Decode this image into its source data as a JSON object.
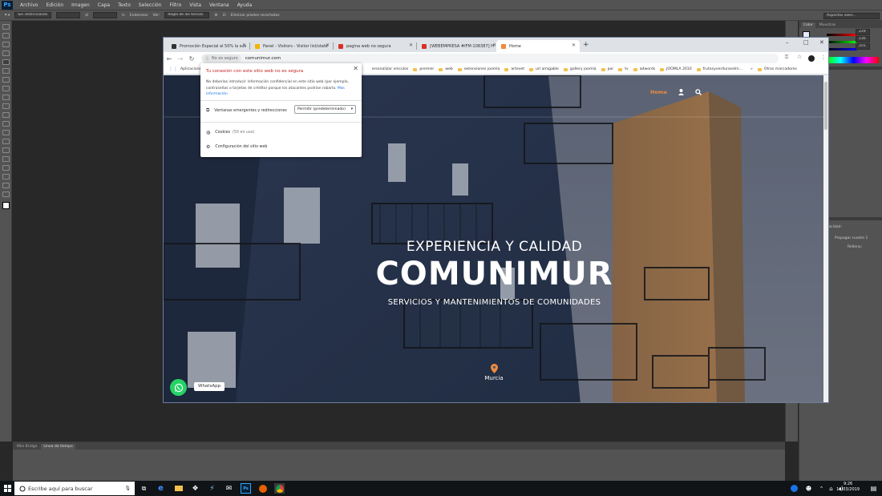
{
  "photoshop": {
    "logo": "Ps",
    "menu": [
      "Archivo",
      "Edición",
      "Imagen",
      "Capa",
      "Texto",
      "Selección",
      "Filtro",
      "Vista",
      "Ventana",
      "Ayuda"
    ],
    "options": {
      "constraint": "Sin restricciones",
      "straighten": "Enderezar",
      "view_label": "Ver:",
      "view_value": "Regla de los tercios",
      "delete_cropped": "Eliminar píxeles recortados",
      "workspace": "Aspectos esen..."
    },
    "right_panel": {
      "tabs": [
        "Color",
        "Muestras"
      ],
      "color_values": [
        "229",
        "236",
        "255"
      ],
      "opacity_label": "Opacidad:",
      "propagate_label": "Propagar cuadro 1",
      "fill_label": "Relleno:"
    },
    "bottom_tabs": [
      "Mini Bridge",
      "Línea de tiempo"
    ]
  },
  "chrome": {
    "tabs": [
      {
        "title": "Promoción Especial al 50% la sus",
        "color": "#333333"
      },
      {
        "title": "Panel - Visitors - Visitor list/state",
        "color": "#f4b400"
      },
      {
        "title": "pagina web no segura",
        "color": "#d93025"
      },
      {
        "title": "[WEBEMPRESA #IFM-108387] H",
        "color": "#d93025"
      },
      {
        "title": "Home",
        "color": "#f08a3c"
      }
    ],
    "new_tab": "+",
    "window_controls": {
      "minimize": "–",
      "maximize": "□",
      "close": "✕"
    },
    "security_chip": "No es seguro",
    "url": "comunimur.com",
    "bookmarks": {
      "apps": "Aplicaciones",
      "items": [
        "ersonalizar vínculos",
        "premier",
        "web",
        "extensiones joomla",
        "artevet",
        "url amigable",
        "gallery joomla",
        "por",
        "tv",
        "adwords",
        "JOOMLA 2010",
        "frutasyverduraselm..."
      ],
      "more": "»",
      "other": "Otros marcadores"
    }
  },
  "popup": {
    "title": "Tu conexión con este sitio web no es segura",
    "body": "No deberías introducir información confidencial en este sitio web (por ejemplo, contraseñas o tarjetas de crédito) porque los atacantes podrían robarla.",
    "link": "Más información",
    "permission_label": "Ventanas emergentes y redirecciones",
    "permission_value": "Permitir (predeterminado)",
    "cookies_label": "Cookies",
    "cookies_count": "(50 en uso)",
    "site_settings": "Configuración del sitio web"
  },
  "site": {
    "nav_home": "Home",
    "kicker": "EXPERIENCIA Y CALIDAD",
    "title": "COMUNIMUR",
    "subtitle": "SERVICIOS Y MANTENIMIENTOS DE COMUNIDADES",
    "location": "Murcia",
    "whatsapp": "WhatsApp",
    "accent": "#f08a3c"
  },
  "taskbar": {
    "search_placeholder": "Escribe aquí para buscar",
    "time": "9:26",
    "date": "12/03/2019"
  }
}
